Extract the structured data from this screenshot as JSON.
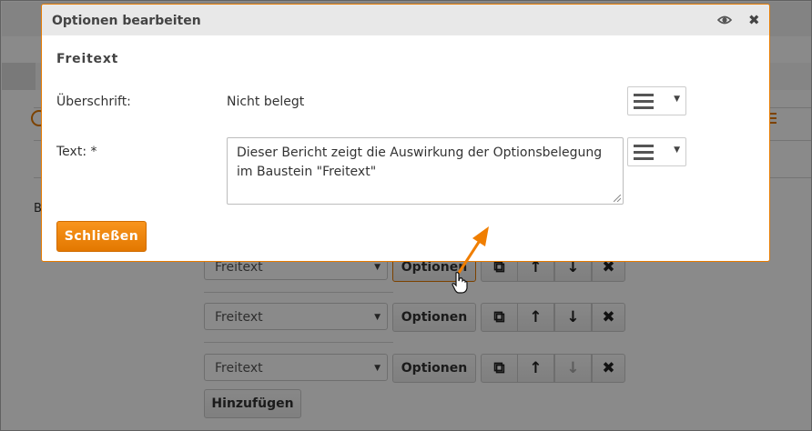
{
  "background": {
    "truncated_label": "B",
    "rows": [
      {
        "select_value": "Freitext",
        "options_label": "Optionen",
        "down_disabled": false
      },
      {
        "select_value": "Freitext",
        "options_label": "Optionen",
        "down_disabled": false
      },
      {
        "select_value": "Freitext",
        "options_label": "Optionen",
        "down_disabled": true
      }
    ],
    "add_label": "Hinzufügen",
    "accent_color": "#e57a00"
  },
  "modal": {
    "title": "Optionen bearbeiten",
    "section_title": "Freitext",
    "heading_label": "Überschrift:",
    "heading_value": "Nicht belegt",
    "text_label": "Text: *",
    "text_value": "Dieser Bericht zeigt die Auswirkung der Optionsbelegung im Baustein \"Freitext\"",
    "close_button": "Schließen",
    "header_icons": [
      "eye-icon",
      "close-icon"
    ]
  }
}
